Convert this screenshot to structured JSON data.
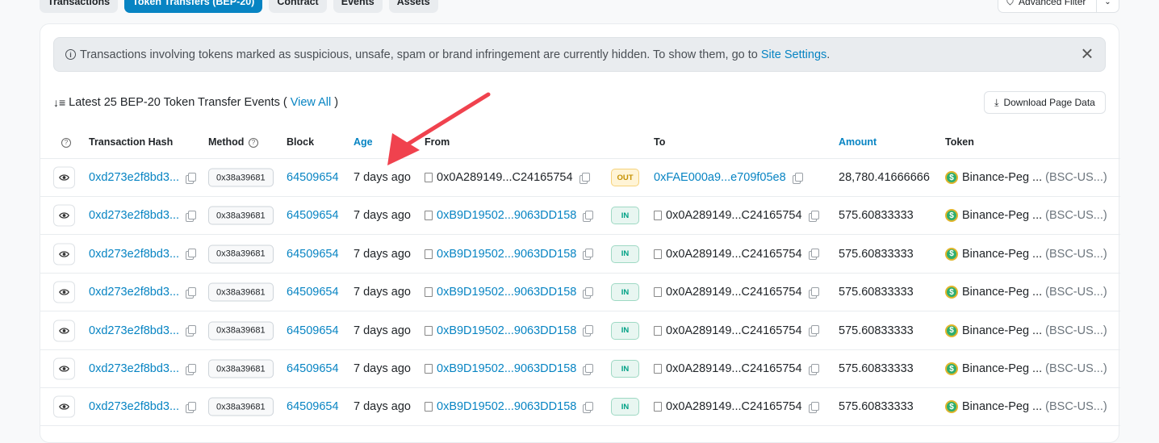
{
  "tabs": [
    {
      "label": "Transactions"
    },
    {
      "label": "Token Transfers (BEP-20)"
    },
    {
      "label": "Contract"
    },
    {
      "label": "Events"
    },
    {
      "label": "Assets"
    }
  ],
  "advanced_filter": {
    "label": "Advanced Filter"
  },
  "alert": {
    "text": "Transactions involving tokens marked as suspicious, unsafe, spam or brand infringement are currently hidden. To show them, go to ",
    "link": "Site Settings",
    "suffix": "."
  },
  "summary": {
    "prefix": "Latest 25 BEP-20 Token Transfer Events (",
    "link": "View All",
    "suffix": ")"
  },
  "download_label": "Download Page Data",
  "columns": {
    "hash": "Transaction Hash",
    "method": "Method",
    "block": "Block",
    "age": "Age",
    "from": "From",
    "to": "To",
    "amount": "Amount",
    "token": "Token"
  },
  "rows": [
    {
      "hash": "0xd273e2f8bd3...",
      "method": "0x38a39681",
      "block": "64509654",
      "age": "7 days ago",
      "from": "0x0A289149...C24165754",
      "dir": "OUT",
      "to": "0xFAE000a9...e709f05e8",
      "amount": "28,780.41666666",
      "token": "Binance-Peg ...",
      "symbol": "(BSC-US...)"
    },
    {
      "hash": "0xd273e2f8bd3...",
      "method": "0x38a39681",
      "block": "64509654",
      "age": "7 days ago",
      "from": "0xB9D19502...9063DD158",
      "dir": "IN",
      "to": "0x0A289149...C24165754",
      "amount": "575.60833333",
      "token": "Binance-Peg ...",
      "symbol": "(BSC-US...)"
    },
    {
      "hash": "0xd273e2f8bd3...",
      "method": "0x38a39681",
      "block": "64509654",
      "age": "7 days ago",
      "from": "0xB9D19502...9063DD158",
      "dir": "IN",
      "to": "0x0A289149...C24165754",
      "amount": "575.60833333",
      "token": "Binance-Peg ...",
      "symbol": "(BSC-US...)"
    },
    {
      "hash": "0xd273e2f8bd3...",
      "method": "0x38a39681",
      "block": "64509654",
      "age": "7 days ago",
      "from": "0xB9D19502...9063DD158",
      "dir": "IN",
      "to": "0x0A289149...C24165754",
      "amount": "575.60833333",
      "token": "Binance-Peg ...",
      "symbol": "(BSC-US...)"
    },
    {
      "hash": "0xd273e2f8bd3...",
      "method": "0x38a39681",
      "block": "64509654",
      "age": "7 days ago",
      "from": "0xB9D19502...9063DD158",
      "dir": "IN",
      "to": "0x0A289149...C24165754",
      "amount": "575.60833333",
      "token": "Binance-Peg ...",
      "symbol": "(BSC-US...)"
    },
    {
      "hash": "0xd273e2f8bd3...",
      "method": "0x38a39681",
      "block": "64509654",
      "age": "7 days ago",
      "from": "0xB9D19502...9063DD158",
      "dir": "IN",
      "to": "0x0A289149...C24165754",
      "amount": "575.60833333",
      "token": "Binance-Peg ...",
      "symbol": "(BSC-US...)"
    },
    {
      "hash": "0xd273e2f8bd3...",
      "method": "0x38a39681",
      "block": "64509654",
      "age": "7 days ago",
      "from": "0xB9D19502...9063DD158",
      "dir": "IN",
      "to": "0x0A289149...C24165754",
      "amount": "575.60833333",
      "token": "Binance-Peg ...",
      "symbol": "(BSC-US...)"
    }
  ],
  "colors": {
    "accent": "#0784c3",
    "annotation_arrow": "#f0424e"
  }
}
